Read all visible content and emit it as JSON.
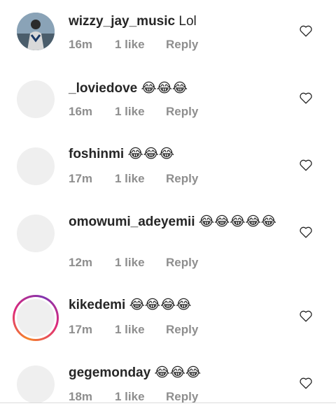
{
  "comments": [
    {
      "user": "wizzy_jay_music",
      "text": "Lol",
      "time": "16m",
      "likes": "1 like",
      "reply": "Reply",
      "avatar": "photo"
    },
    {
      "user": "_loviedove",
      "text": "😂😂😂",
      "time": "16m",
      "likes": "1 like",
      "reply": "Reply",
      "avatar": "placeholder"
    },
    {
      "user": "foshinmi",
      "text": "😂😂😂",
      "time": "17m",
      "likes": "1 like",
      "reply": "Reply",
      "avatar": "placeholder"
    },
    {
      "user": "omowumi_adeyemii",
      "text": "😂😂😂😂😂",
      "time": "12m",
      "likes": "1 like",
      "reply": "Reply",
      "avatar": "placeholder"
    },
    {
      "user": "kikedemi",
      "text": "😂😂😂😂",
      "time": "17m",
      "likes": "1 like",
      "reply": "Reply",
      "avatar": "story-ring"
    },
    {
      "user": "gegemonday",
      "text": "😂😂😂",
      "time": "18m",
      "likes": "1 like",
      "reply": "Reply",
      "avatar": "placeholder"
    }
  ],
  "icons": {
    "like": "heart-outline-icon"
  },
  "colors": {
    "username": "#262626",
    "meta": "#8e8e8e",
    "avatar_placeholder": "#efefef",
    "divider": "#dbdbdb"
  }
}
